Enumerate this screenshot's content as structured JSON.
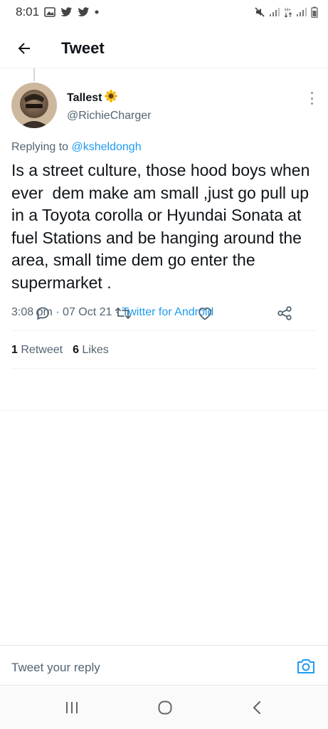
{
  "status_bar": {
    "time": "8:01",
    "left_icons": [
      "gallery-icon",
      "twitter-icon",
      "twitter-icon",
      "dot-icon"
    ],
    "right_icons": [
      "mute-icon",
      "signal-icon",
      "data-icon",
      "signal-icon",
      "battery-icon"
    ]
  },
  "header": {
    "title": "Tweet",
    "back_icon": "arrow-left-icon"
  },
  "tweet": {
    "author_name": "Tallest",
    "author_emoji": "🌻",
    "author_handle": "@RichieCharger",
    "replying_prefix": "Replying to",
    "replying_to": "@ksheldongh",
    "text": "Is a street culture, those hood boys when ever  dem make am small ,just go pull up in a Toyota corolla or Hyundai Sonata at fuel Stations and be hanging around the area, small time dem go enter the supermarket .",
    "time": "3:08 pm",
    "date": "07 Oct 21",
    "separator": "·",
    "source": "Twitter for Android",
    "retweet_count": "1",
    "retweet_label": "Retweet",
    "like_count": "6",
    "like_label": "Likes"
  },
  "actions": [
    "reply-icon",
    "retweet-icon",
    "like-icon",
    "share-icon"
  ],
  "reply_bar": {
    "placeholder": "Tweet your reply",
    "icon": "camera-icon"
  },
  "nav": [
    "recents-icon",
    "home-icon",
    "back-icon"
  ],
  "colors": {
    "accent": "#1d9bf0",
    "secondary_text": "#536471",
    "text": "#0f1419",
    "divider": "#eff3f4"
  }
}
